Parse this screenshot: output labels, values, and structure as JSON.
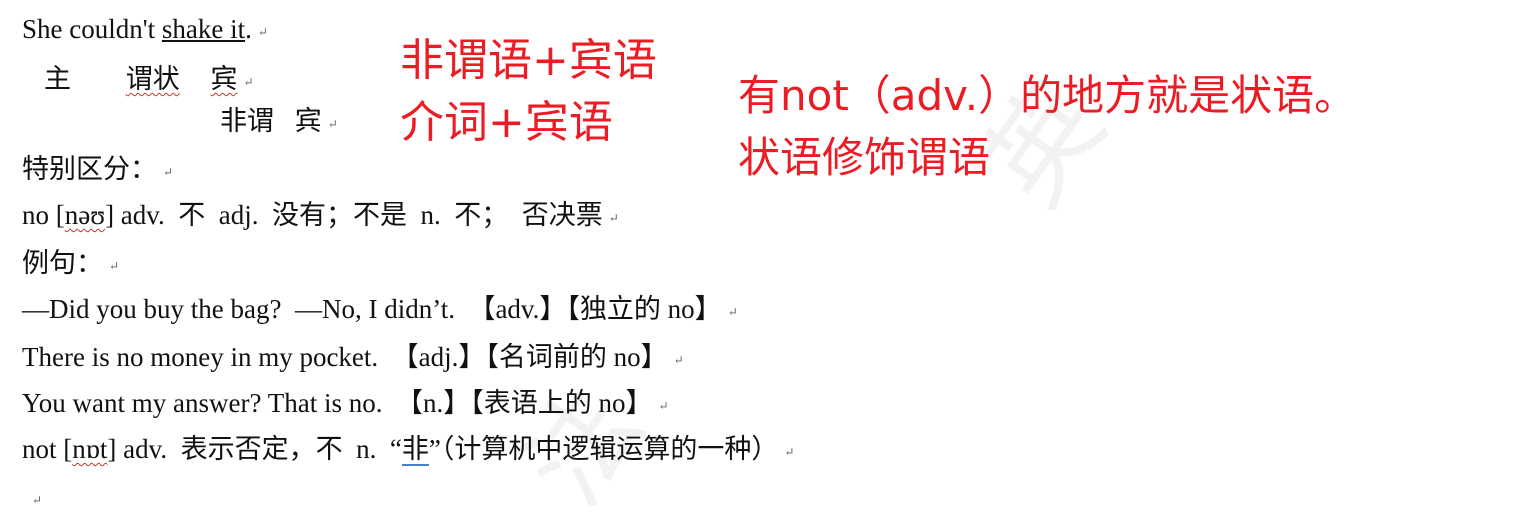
{
  "lines": {
    "l1": {
      "pre": "She couldn't ",
      "underlined": "shake it",
      "post": "."
    },
    "l2": {
      "subj": "主",
      "pred_adv": "谓状",
      "obj": "宾"
    },
    "l3": {
      "nonpred": "非谓",
      "obj": "宾"
    },
    "l4": {
      "text": "特别区分："
    },
    "l5": {
      "pre": "no [",
      "phonetic": "nəʊ",
      "post": "] adv.  不  adj.  没有；不是  n.  不；  否决票"
    },
    "l6": {
      "text": "例句："
    },
    "l7": {
      "text": "—Did you buy the bag?  —No, I didn’t.  【adv.】【独立的 no】"
    },
    "l8": {
      "text": "There is no money in my pocket.  【adj.】【名词前的 no】"
    },
    "l9": {
      "text": "You want my answer? That is no.  【n.】【表语上的 no】"
    },
    "l10": {
      "pre": "not [",
      "phonetic": "nɒt",
      "mid": "] adv.  表示否定，不  n.  “",
      "highlight": "非",
      "post": "”（计算机中逻辑运算的一种）"
    }
  },
  "annotations": {
    "a1": "非谓语+宾语",
    "a2": "介词+宾语",
    "a3": "有not（adv.）的地方就是状语。",
    "a4": "状语修饰谓语"
  },
  "paragraph_mark": "↵",
  "colors": {
    "annotation": "#ec1c24",
    "text": "#111111",
    "highlight_underline": "#4a7ec7"
  }
}
